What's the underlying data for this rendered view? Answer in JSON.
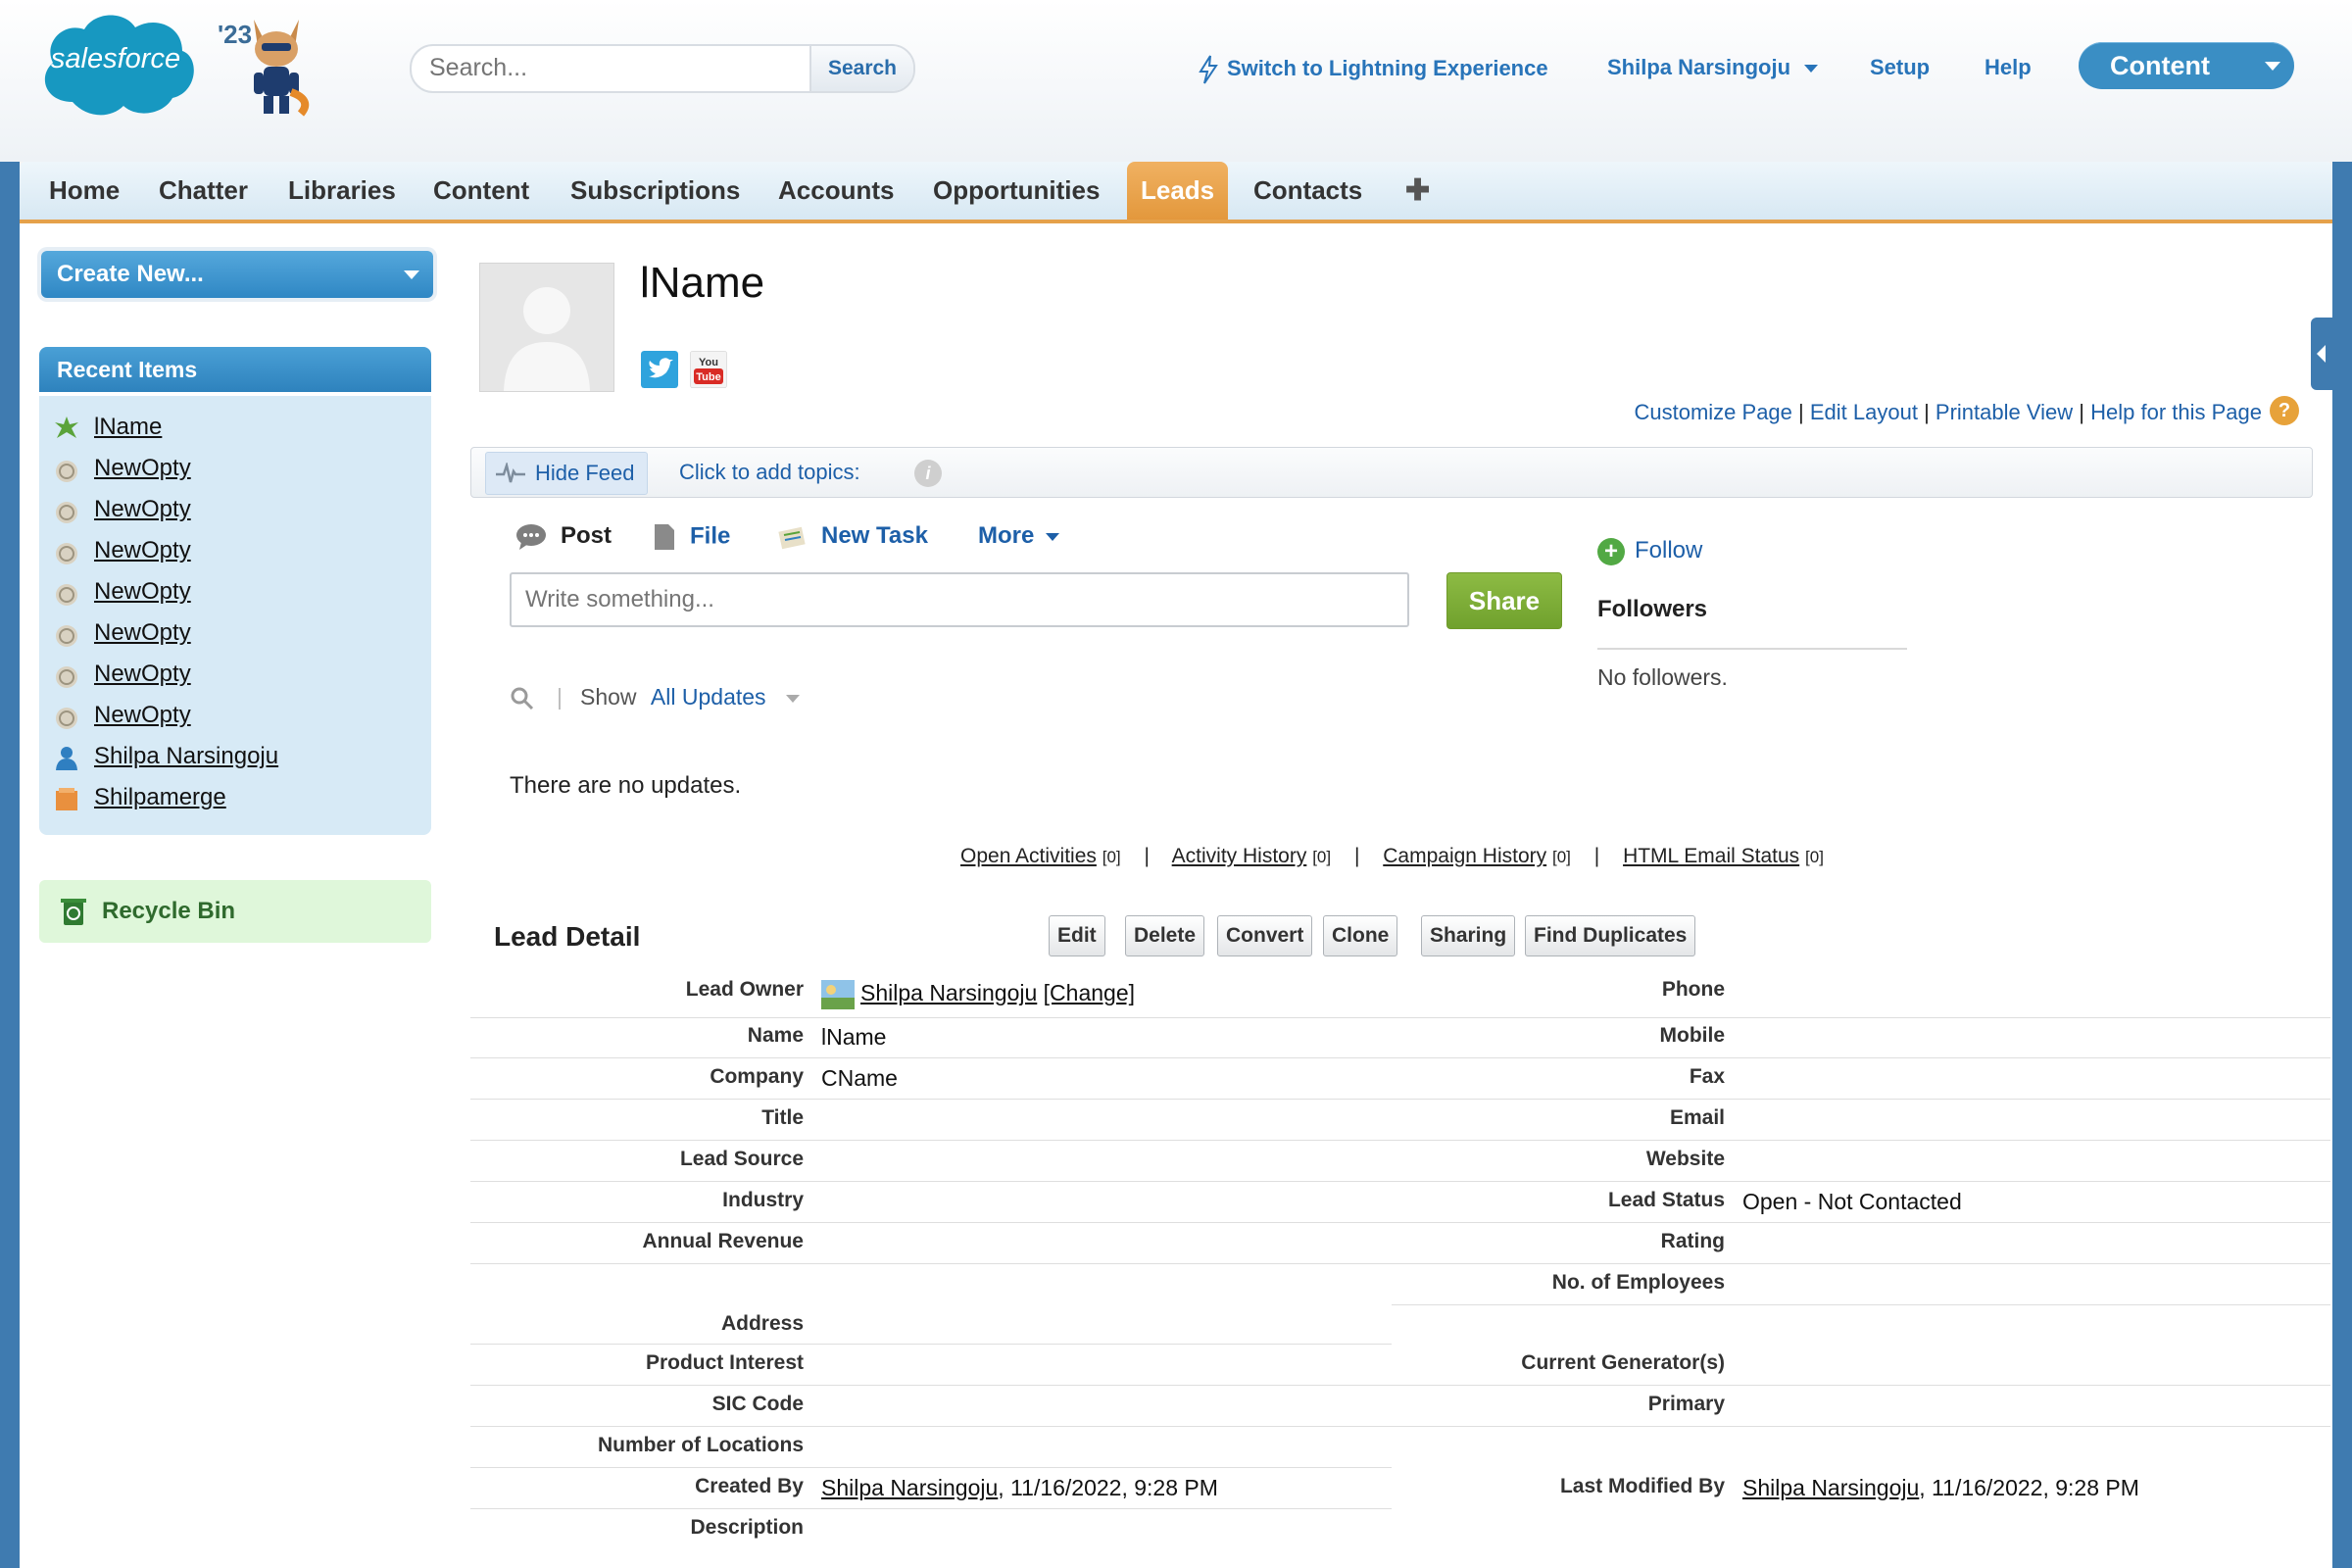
{
  "header": {
    "logo_text": "salesforce",
    "logo_year": "'23",
    "search_placeholder": "Search...",
    "search_button": "Search",
    "lightning_link": "Switch to Lightning Experience",
    "user_menu": "Shilpa Narsingoju",
    "setup": "Setup",
    "help": "Help",
    "app_switcher": "Content"
  },
  "tabs": [
    "Home",
    "Chatter",
    "Libraries",
    "Content",
    "Subscriptions",
    "Accounts",
    "Opportunities",
    "Leads",
    "Contacts"
  ],
  "active_tab": "Leads",
  "tab_plus": "✚",
  "sidebar": {
    "create_new": "Create New...",
    "recent_items_title": "Recent Items",
    "recent_items": [
      {
        "label": "lName",
        "icon": "lead-icon"
      },
      {
        "label": "NewOpty",
        "icon": "opportunity-icon"
      },
      {
        "label": "NewOpty",
        "icon": "opportunity-icon"
      },
      {
        "label": "NewOpty",
        "icon": "opportunity-icon"
      },
      {
        "label": "NewOpty",
        "icon": "opportunity-icon"
      },
      {
        "label": "NewOpty",
        "icon": "opportunity-icon"
      },
      {
        "label": "NewOpty",
        "icon": "opportunity-icon"
      },
      {
        "label": "NewOpty",
        "icon": "opportunity-icon"
      },
      {
        "label": "Shilpa Narsingoju",
        "icon": "user-icon"
      },
      {
        "label": "Shilpamerge",
        "icon": "account-icon"
      }
    ],
    "recycle_bin": "Recycle Bin"
  },
  "record": {
    "title": "lName",
    "links": {
      "customize": "Customize Page",
      "edit_layout": "Edit Layout",
      "printable": "Printable View",
      "help": "Help for this Page",
      "separator": "|"
    }
  },
  "feed": {
    "hide_feed": "Hide Feed",
    "add_topics": "Click to add topics:",
    "info": "i",
    "publisher_tabs": {
      "post": "Post",
      "file": "File",
      "new_task": "New Task",
      "more": "More"
    },
    "write_placeholder": "Write something...",
    "share": "Share",
    "follow": "Follow",
    "followers_title": "Followers",
    "no_followers": "No followers.",
    "show_label": "Show",
    "show_filter": "All Updates",
    "no_updates": "There are no updates."
  },
  "related": [
    {
      "label": "Open Activities",
      "count": "[0]"
    },
    {
      "label": "Activity History",
      "count": "[0]"
    },
    {
      "label": "Campaign History",
      "count": "[0]"
    },
    {
      "label": "HTML Email Status",
      "count": "[0]"
    }
  ],
  "detail": {
    "title": "Lead Detail",
    "buttons": [
      "Edit",
      "Delete",
      "Convert",
      "Clone",
      "Sharing",
      "Find Duplicates"
    ],
    "left": {
      "lead_owner": {
        "label": "Lead Owner",
        "value": "Shilpa Narsingoju",
        "change": "[Change]"
      },
      "name": {
        "label": "Name",
        "value": "lName"
      },
      "company": {
        "label": "Company",
        "value": "CName"
      },
      "title": {
        "label": "Title",
        "value": ""
      },
      "lead_source": {
        "label": "Lead Source",
        "value": ""
      },
      "industry": {
        "label": "Industry",
        "value": ""
      },
      "annual_revenue": {
        "label": "Annual Revenue",
        "value": ""
      },
      "address": {
        "label": "Address",
        "value": ""
      },
      "product_interest": {
        "label": "Product Interest",
        "value": ""
      },
      "sic_code": {
        "label": "SIC Code",
        "value": ""
      },
      "num_locations": {
        "label": "Number of Locations",
        "value": ""
      },
      "created_by": {
        "label": "Created By",
        "user": "Shilpa Narsingoju",
        "date": ", 11/16/2022, 9:28 PM"
      },
      "description": {
        "label": "Description",
        "value": ""
      }
    },
    "right": {
      "phone": {
        "label": "Phone",
        "value": ""
      },
      "mobile": {
        "label": "Mobile",
        "value": ""
      },
      "fax": {
        "label": "Fax",
        "value": ""
      },
      "email": {
        "label": "Email",
        "value": ""
      },
      "website": {
        "label": "Website",
        "value": ""
      },
      "lead_status": {
        "label": "Lead Status",
        "value": "Open - Not Contacted"
      },
      "rating": {
        "label": "Rating",
        "value": ""
      },
      "employees": {
        "label": "No. of Employees",
        "value": ""
      },
      "current_generators": {
        "label": "Current Generator(s)",
        "value": ""
      },
      "primary": {
        "label": "Primary",
        "value": ""
      },
      "last_modified_by": {
        "label": "Last Modified By",
        "user": "Shilpa Narsingoju",
        "date": ", 11/16/2022, 9:28 PM"
      }
    }
  },
  "colors": {
    "brand_blue": "#3a8ec4",
    "active_tab": "#e3983c",
    "share_green": "#70a12d"
  }
}
